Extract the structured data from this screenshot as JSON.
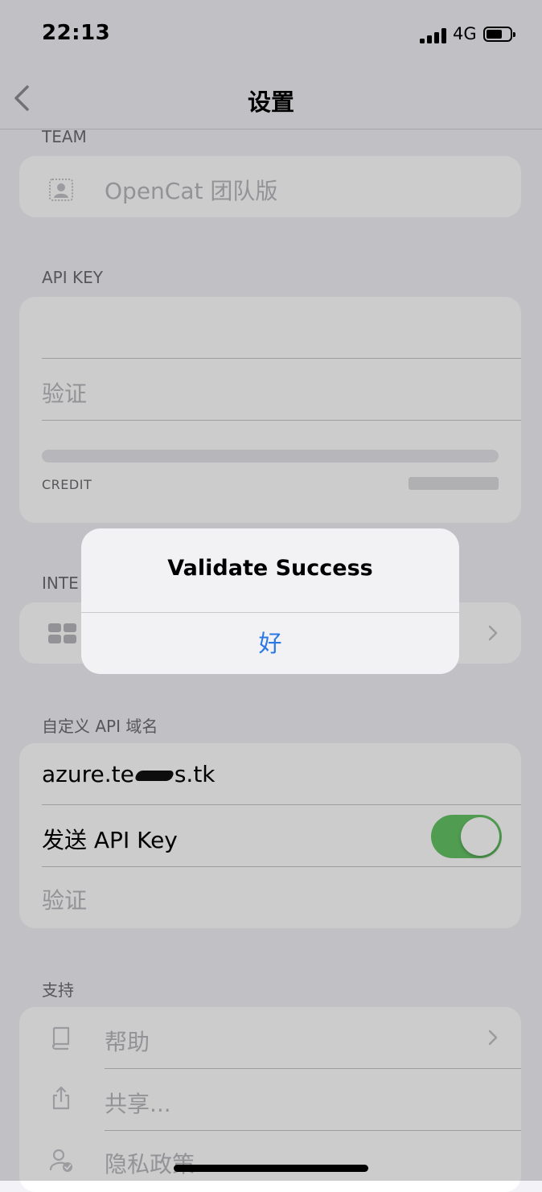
{
  "status_bar": {
    "time": "22:13",
    "network": "4G"
  },
  "nav": {
    "title": "设置"
  },
  "team": {
    "header": "TEAM",
    "item_label": "OpenCat 团队版"
  },
  "api_key": {
    "header": "API KEY",
    "verify_label": "验证",
    "credit_label": "CREDIT"
  },
  "integration": {
    "header": "INTE"
  },
  "custom_domain": {
    "header": "自定义 API 域名",
    "domain_prefix": "azure.te",
    "domain_suffix": "s.tk",
    "send_key_label": "发送 API Key",
    "send_key_on": true,
    "verify_label": "验证"
  },
  "support": {
    "header": "支持",
    "items": [
      {
        "label": "帮助",
        "icon": "book-icon"
      },
      {
        "label": "共享...",
        "icon": "share-icon"
      },
      {
        "label": "隐私政策",
        "icon": "privacy-icon"
      }
    ]
  },
  "alert": {
    "title": "Validate Success",
    "ok_label": "好"
  },
  "colors": {
    "toggle_on": "#65c466",
    "link": "#2a78e4",
    "background": "#f2f2f7"
  }
}
